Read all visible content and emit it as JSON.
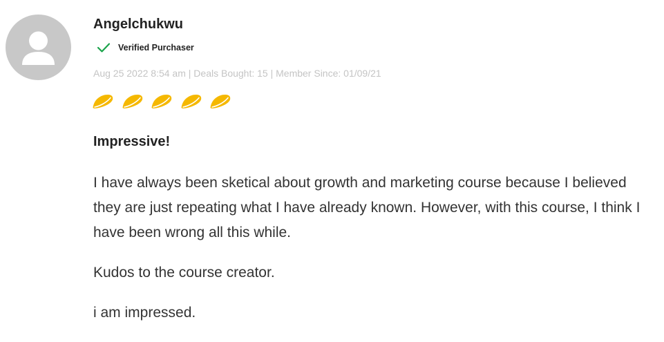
{
  "review": {
    "author": "Angelchukwu",
    "verified_label": "Verified Purchaser",
    "meta": "Aug 25 2022 8:54 am | Deals Bought: 15 | Member Since: 01/09/21",
    "rating": 5,
    "rating_max": 5,
    "title": "Impressive!",
    "paragraphs": [
      "I have always been sketical about growth and marketing course because I believed they are just repeating what I have already known. However, with this course, I think I have been wrong all this while.",
      "Kudos to the course creator.",
      "i am impressed."
    ]
  },
  "icons": {
    "avatar": "user-silhouette-icon",
    "verified": "checkmark-icon",
    "rating": "taco-icon"
  },
  "colors": {
    "avatar_bg": "#c8c8c8",
    "checkmark": "#1aa34a",
    "taco": "#f5b800",
    "meta_text": "#c4c4c4"
  }
}
